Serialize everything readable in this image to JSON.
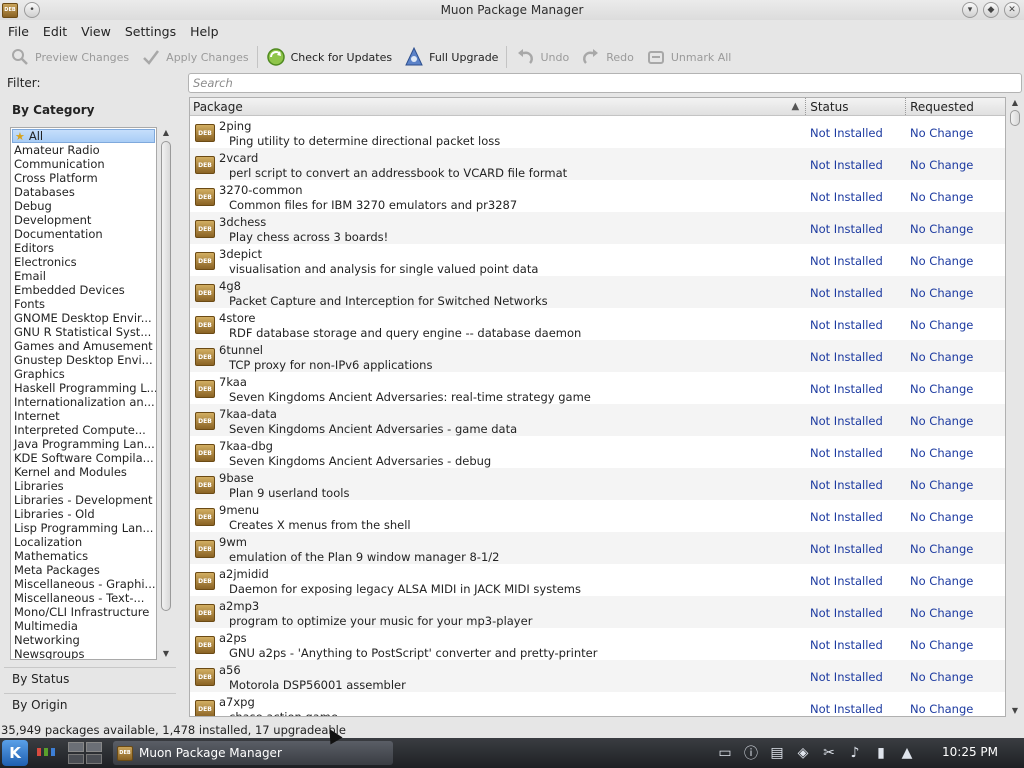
{
  "window": {
    "title": "Muon Package Manager"
  },
  "menu": [
    "File",
    "Edit",
    "View",
    "Settings",
    "Help"
  ],
  "toolbar": {
    "preview": "Preview Changes",
    "apply": "Apply Changes",
    "check": "Check for Updates",
    "upgrade": "Full Upgrade",
    "undo": "Undo",
    "redo": "Redo",
    "unmark": "Unmark All"
  },
  "filter": {
    "label": "Filter:",
    "by_category": "By Category",
    "by_status": "By Status",
    "by_origin": "By Origin",
    "categories": [
      "All",
      "Amateur Radio",
      "Communication",
      "Cross Platform",
      "Databases",
      "Debug",
      "Development",
      "Documentation",
      "Editors",
      "Electronics",
      "Email",
      "Embedded Devices",
      "Fonts",
      "GNOME Desktop Envir...",
      "GNU R Statistical Syst...",
      "Games and Amusement",
      "Gnustep Desktop Envi...",
      "Graphics",
      "Haskell Programming L...",
      "Internationalization an...",
      "Internet",
      "Interpreted Compute...",
      "Java Programming Lan...",
      "KDE Software Compila...",
      "Kernel and Modules",
      "Libraries",
      "Libraries - Development",
      "Libraries - Old",
      "Lisp Programming Lan...",
      "Localization",
      "Mathematics",
      "Meta Packages",
      "Miscellaneous - Graphi...",
      "Miscellaneous - Text-...",
      "Mono/CLI Infrastructure",
      "Multimedia",
      "Networking",
      "Newsgroups"
    ]
  },
  "search": {
    "placeholder": "Search"
  },
  "table": {
    "columns": [
      "Package",
      "Status",
      "Requested"
    ],
    "rows": [
      {
        "name": "2ping",
        "desc": "Ping utility to determine directional packet loss",
        "status": "Not Installed",
        "requested": "No Change"
      },
      {
        "name": "2vcard",
        "desc": "perl script to convert an addressbook to VCARD file format",
        "status": "Not Installed",
        "requested": "No Change"
      },
      {
        "name": "3270-common",
        "desc": "Common files for IBM 3270 emulators and pr3287",
        "status": "Not Installed",
        "requested": "No Change"
      },
      {
        "name": "3dchess",
        "desc": "Play chess across 3 boards!",
        "status": "Not Installed",
        "requested": "No Change"
      },
      {
        "name": "3depict",
        "desc": "visualisation and analysis for single valued point data",
        "status": "Not Installed",
        "requested": "No Change"
      },
      {
        "name": "4g8",
        "desc": "Packet Capture and Interception for Switched Networks",
        "status": "Not Installed",
        "requested": "No Change"
      },
      {
        "name": "4store",
        "desc": "RDF database storage and query engine -- database daemon",
        "status": "Not Installed",
        "requested": "No Change"
      },
      {
        "name": "6tunnel",
        "desc": "TCP proxy for non-IPv6 applications",
        "status": "Not Installed",
        "requested": "No Change"
      },
      {
        "name": "7kaa",
        "desc": "Seven Kingdoms Ancient Adversaries: real-time strategy game",
        "status": "Not Installed",
        "requested": "No Change"
      },
      {
        "name": "7kaa-data",
        "desc": "Seven Kingdoms Ancient Adversaries - game data",
        "status": "Not Installed",
        "requested": "No Change"
      },
      {
        "name": "7kaa-dbg",
        "desc": "Seven Kingdoms Ancient Adversaries - debug",
        "status": "Not Installed",
        "requested": "No Change"
      },
      {
        "name": "9base",
        "desc": "Plan 9 userland tools",
        "status": "Not Installed",
        "requested": "No Change"
      },
      {
        "name": "9menu",
        "desc": "Creates X menus from the shell",
        "status": "Not Installed",
        "requested": "No Change"
      },
      {
        "name": "9wm",
        "desc": "emulation of the Plan 9 window manager 8-1/2",
        "status": "Not Installed",
        "requested": "No Change"
      },
      {
        "name": "a2jmidid",
        "desc": "Daemon for exposing legacy ALSA MIDI in JACK MIDI systems",
        "status": "Not Installed",
        "requested": "No Change"
      },
      {
        "name": "a2mp3",
        "desc": "program to optimize your music for your mp3-player",
        "status": "Not Installed",
        "requested": "No Change"
      },
      {
        "name": "a2ps",
        "desc": "GNU a2ps - 'Anything to PostScript' converter and pretty-printer",
        "status": "Not Installed",
        "requested": "No Change"
      },
      {
        "name": "a56",
        "desc": "Motorola DSP56001 assembler",
        "status": "Not Installed",
        "requested": "No Change"
      },
      {
        "name": "a7xpg",
        "desc": "chase action game",
        "status": "Not Installed",
        "requested": "No Change"
      }
    ]
  },
  "statusbar": "35,949 packages available, 1,478 installed, 17 upgradeable",
  "taskbar": {
    "task_label": "Muon Package Manager",
    "clock": "10:25 PM"
  }
}
